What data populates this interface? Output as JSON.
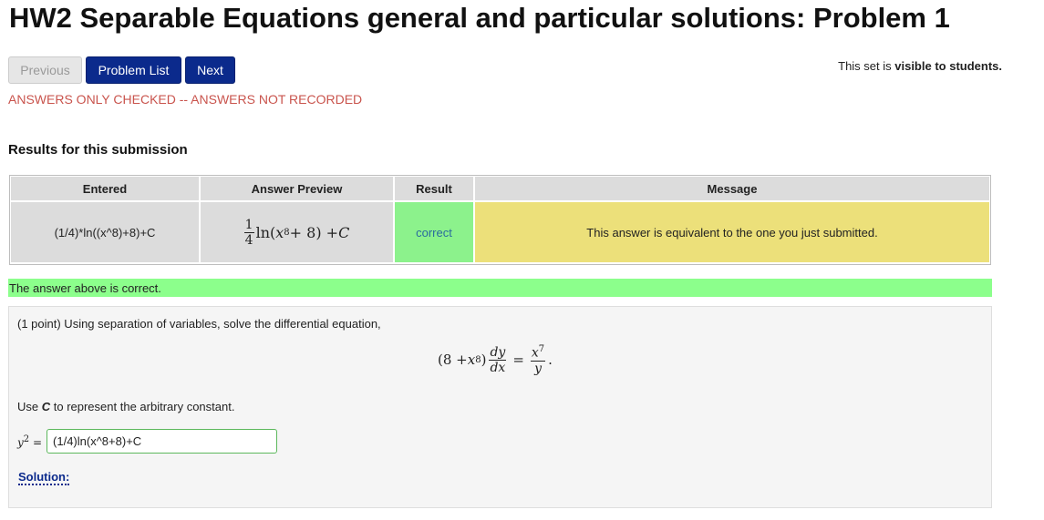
{
  "page": {
    "title": "HW2 Separable Equations general and particular solutions: Problem 1"
  },
  "nav": {
    "previous_label": "Previous",
    "problem_list_label": "Problem List",
    "next_label": "Next"
  },
  "visibility": {
    "prefix": "This set is ",
    "status": "visible to students."
  },
  "warning": "ANSWERS ONLY CHECKED -- ANSWERS NOT RECORDED",
  "results": {
    "title": "Results for this submission",
    "headers": [
      "Entered",
      "Answer Preview",
      "Result",
      "Message"
    ],
    "row": {
      "entered": "(1/4)*ln((x^8)+8)+C",
      "preview": {
        "frac_num": "1",
        "frac_den": "4",
        "func": "ln",
        "x": "x",
        "exp": "8",
        "rest": " + 8",
        "plus_c": "+ ",
        "c": "C"
      },
      "result": "correct",
      "message": "This answer is equivalent to the one you just submitted."
    }
  },
  "correct_banner": "The answer above is correct.",
  "problem": {
    "intro": "(1 point) Using separation of variables, solve the differential equation,",
    "equation": {
      "lhs_open": "(8 + ",
      "x": "x",
      "exp8": "8",
      "lhs_close": ")",
      "dy": "dy",
      "dx": "dx",
      "equals": "=",
      "rhs_num_x": "x",
      "exp7": "7",
      "rhs_den": "y",
      "period": "."
    },
    "use_c": {
      "prefix": "Use ",
      "c": "C",
      "suffix": " to represent the arbitrary constant."
    },
    "answer": {
      "label_var": "y",
      "label_exp": "2",
      "label_eq": " =",
      "value": "(1/4)ln(x^8+8)+C"
    },
    "solution_label": "Solution:"
  },
  "colors": {
    "primary_button": "#0b2a8c",
    "warning_text": "#c9544d",
    "correct_cell": "#8cf28c",
    "message_cell": "#ece07a",
    "correct_banner": "#8cff8c"
  }
}
